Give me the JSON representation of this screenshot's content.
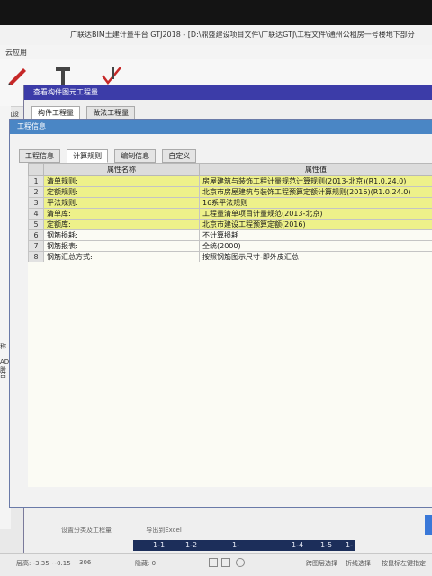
{
  "window": {
    "title": "广联达BIM土建计量平台 GTJ2018 - [D:\\鼎盛建设项目文件\\广联达GTJ\\工程文件\\通州公租房一号楼地下部分"
  },
  "menu": {
    "items": [
      "云应用"
    ]
  },
  "ribbon": {
    "left_label": "构筑设"
  },
  "left_panel": {
    "fragments": [
      "称",
      "AD 股",
      "吕"
    ]
  },
  "outer_dialog": {
    "title": "查看构件图元工程量",
    "tabs": [
      "构件工程量",
      "做法工程量"
    ]
  },
  "inner_dialog": {
    "title": "工程信息",
    "tabs": [
      "工程信息",
      "计算规则",
      "编制信息",
      "自定义"
    ],
    "active_tab": "计算规则",
    "table": {
      "headers": [
        "属性名称",
        "属性值"
      ],
      "rows": [
        {
          "no": "1",
          "name": "清单规则:",
          "value": "房屋建筑与装饰工程计量规范计算规则(2013-北京)(R1.0.24.0)",
          "highlight": true
        },
        {
          "no": "2",
          "name": "定额规则:",
          "value": "北京市房屋建筑与装饰工程预算定额计算规则(2016)(R1.0.24.0)",
          "highlight": true
        },
        {
          "no": "3",
          "name": "平法规则:",
          "value": "16系平法规则",
          "highlight": true
        },
        {
          "no": "4",
          "name": "清单库:",
          "value": "工程量清单项目计量规范(2013-北京)",
          "highlight": true
        },
        {
          "no": "5",
          "name": "定额库:",
          "value": "北京市建设工程预算定额(2016)",
          "highlight": true
        },
        {
          "no": "6",
          "name": "钢筋损耗:",
          "value": "不计算损耗",
          "highlight": false
        },
        {
          "no": "7",
          "name": "钢筋报表:",
          "value": "全统(2000)",
          "highlight": false
        },
        {
          "no": "8",
          "name": "钢筋汇总方式:",
          "value": "按照钢筋图示尺寸-即外皮汇总",
          "highlight": false
        }
      ]
    }
  },
  "bottom": {
    "links": [
      "设置分类及工程量",
      "导出到Excel"
    ],
    "axis_labels": [
      "1-1",
      "1-2",
      "1-",
      "1-4",
      "1-5",
      "1-"
    ],
    "status": {
      "left": "层高: -3.35~-0.15",
      "coord": "306",
      "center": "隐藏: 0",
      "buttons": [
        "跨图层选择",
        "折线选择",
        "按鼠标左键指定"
      ]
    }
  },
  "colors": {
    "title_blue": "#3c3ca8",
    "inner_title_blue": "#4a86c5",
    "highlight_yellow": "#eef18a",
    "axis_dark": "#1c2e5a"
  }
}
